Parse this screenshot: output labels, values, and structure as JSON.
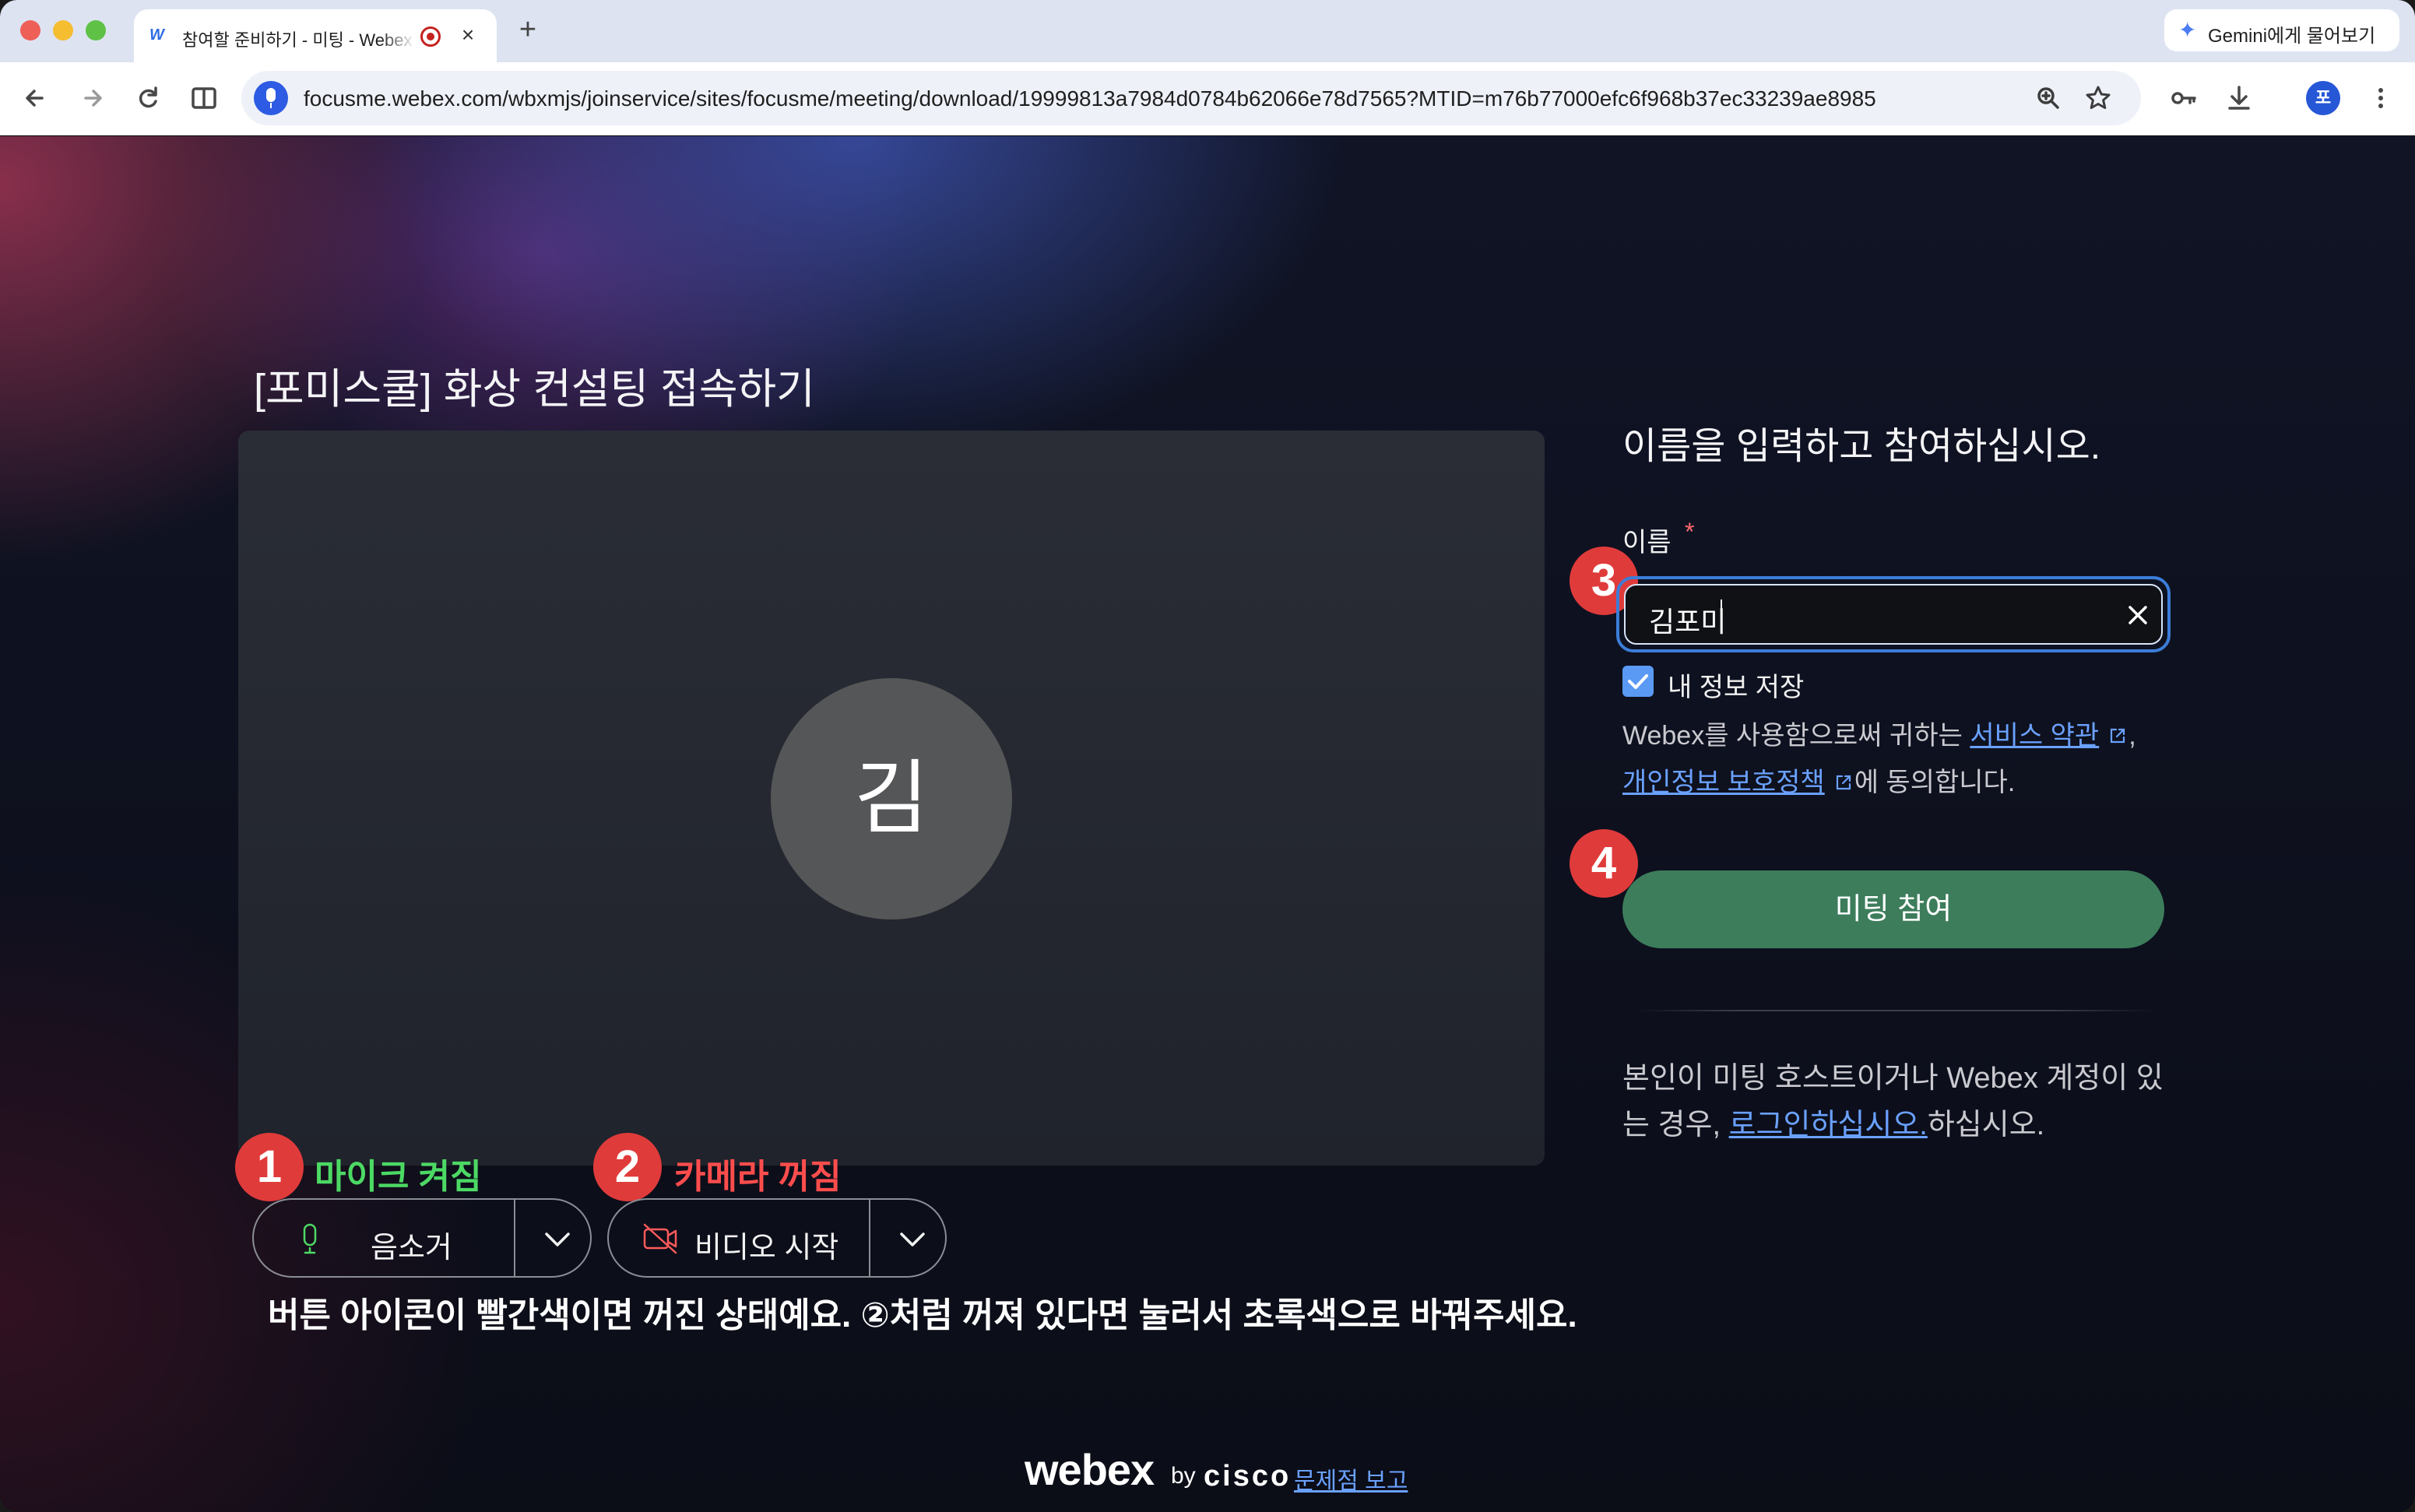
{
  "browser": {
    "tab_title": "참여할 준비하기 - 미팅 - Webex",
    "tab_favicon": "webex-icon",
    "url": "focusme.webex.com/wbxmjs/joinservice/sites/focusme/meeting/download/19999813a7984d0784b62066e78d7565?MTID=m76b77000efc6f968b37ec33239ae8985",
    "gemini_label": "Gemini에게 물어보기",
    "profile_initial": "포"
  },
  "meeting": {
    "title": "[포미스쿨] 화상 컨설팅 접속하기",
    "avatar_initial": "김"
  },
  "controls": {
    "mute_label": "음소거",
    "video_label": "비디오 시작"
  },
  "annotations": {
    "step1_number": "1",
    "step1_label": "마이크 켜짐",
    "step1_color": "#4cd964",
    "step2_number": "2",
    "step2_label": "카메라 꺼짐",
    "step2_color": "#ff4d4d",
    "step3_number": "3",
    "step4_number": "4",
    "instruction": "버튼 아이콘이 빨간색이면 꺼진 상태예요. ②처럼 꺼져 있다면 눌러서 초록색으로 바꿔주세요."
  },
  "join_panel": {
    "heading": "이름을 입력하고 참여하십시오.",
    "name_label": "이름",
    "required_mark": "*",
    "name_value": "김포미",
    "save_info_label": "내 정보 저장",
    "save_info_checked": true,
    "terms_prefix": "Webex를 사용함으로써 귀하는 ",
    "terms_link": "서비스 약관",
    "terms_comma": ",",
    "privacy_link": "개인정보 보호정책",
    "terms_suffix": "에 동의합니다.",
    "join_button": "미팅 참여",
    "host_prefix": "본인이 미팅 호스트이거나 Webex 계정이 있는 경우, ",
    "login_link": "로그인하십시오.",
    "host_suffix": "하십시오."
  },
  "footer": {
    "brand": "webex",
    "by": "by",
    "cisco": "cisco",
    "report_link": "문제점 보고"
  },
  "colors": {
    "join_button": "#3d7d5c",
    "link": "#6aa1ff",
    "badge": "#e03b3b",
    "input_focus": "#3c7dd8"
  }
}
